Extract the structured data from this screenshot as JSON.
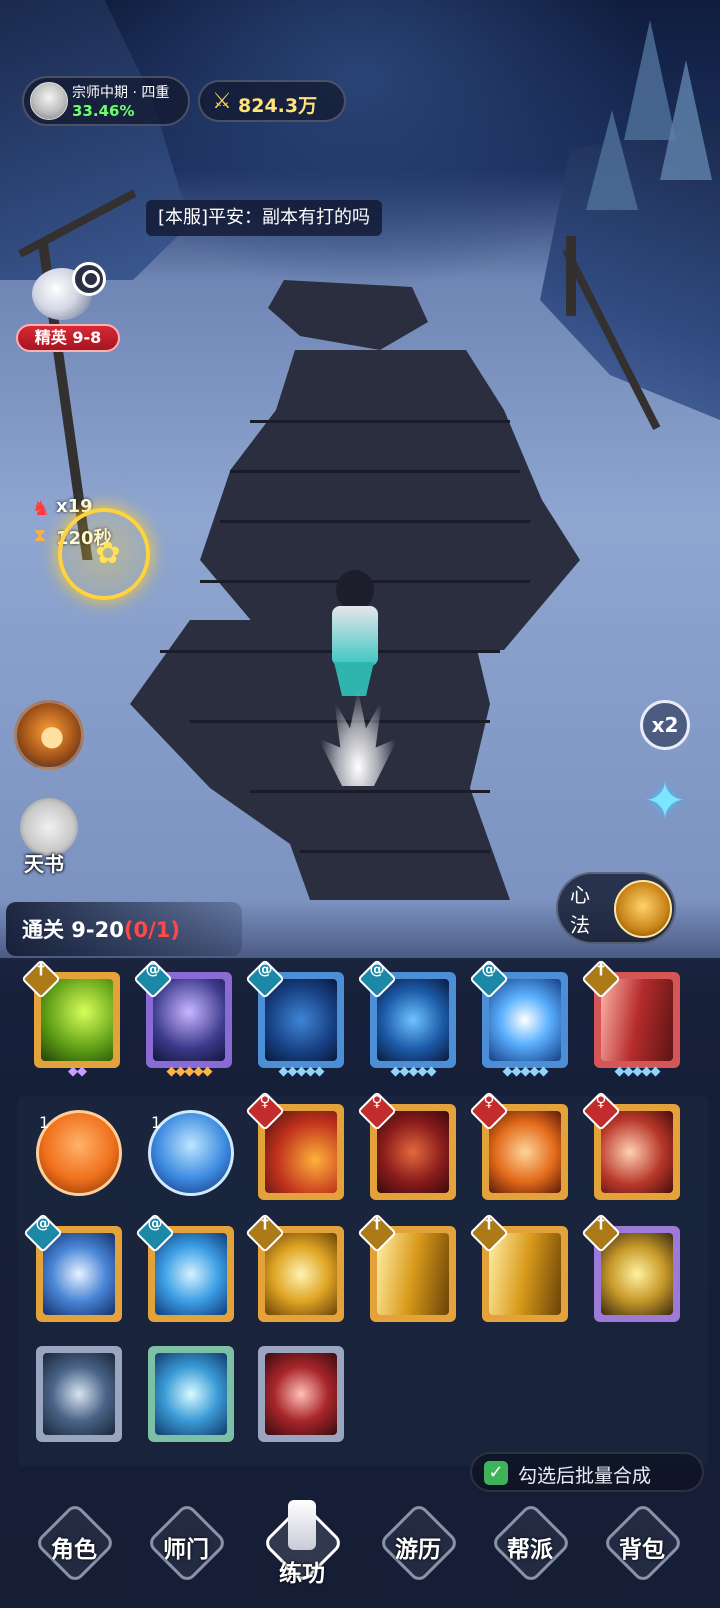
{
  "hud": {
    "rank_title": "宗师中期 · 四重",
    "rank_percent": "33.46%",
    "power_value": "824.3万",
    "chat_message": "[本服]平安：副本有打的吗"
  },
  "dungeon": {
    "label": "精英 9-8"
  },
  "status": {
    "buff_count": "x19",
    "timer": "120秒"
  },
  "side_buttons": {
    "tianshu_label": "天书",
    "speed_label": "x2",
    "xinfa_label": "心法"
  },
  "quest": {
    "prefix": "通关 9-20",
    "progress": "(0/1)"
  },
  "cards": {
    "orb_counts": [
      "1",
      "1"
    ]
  },
  "merge": {
    "label": "勾选后批量合成",
    "checked": true
  },
  "nav": {
    "items": [
      "角色",
      "师门",
      "练功",
      "游历",
      "帮派",
      "背包"
    ],
    "active": "练功"
  },
  "colors": {
    "accent_green": "#6dff6a",
    "power_gold": "#ffe27a",
    "progress_red": "#ff4848",
    "dungeon_red": "#d82a35"
  }
}
